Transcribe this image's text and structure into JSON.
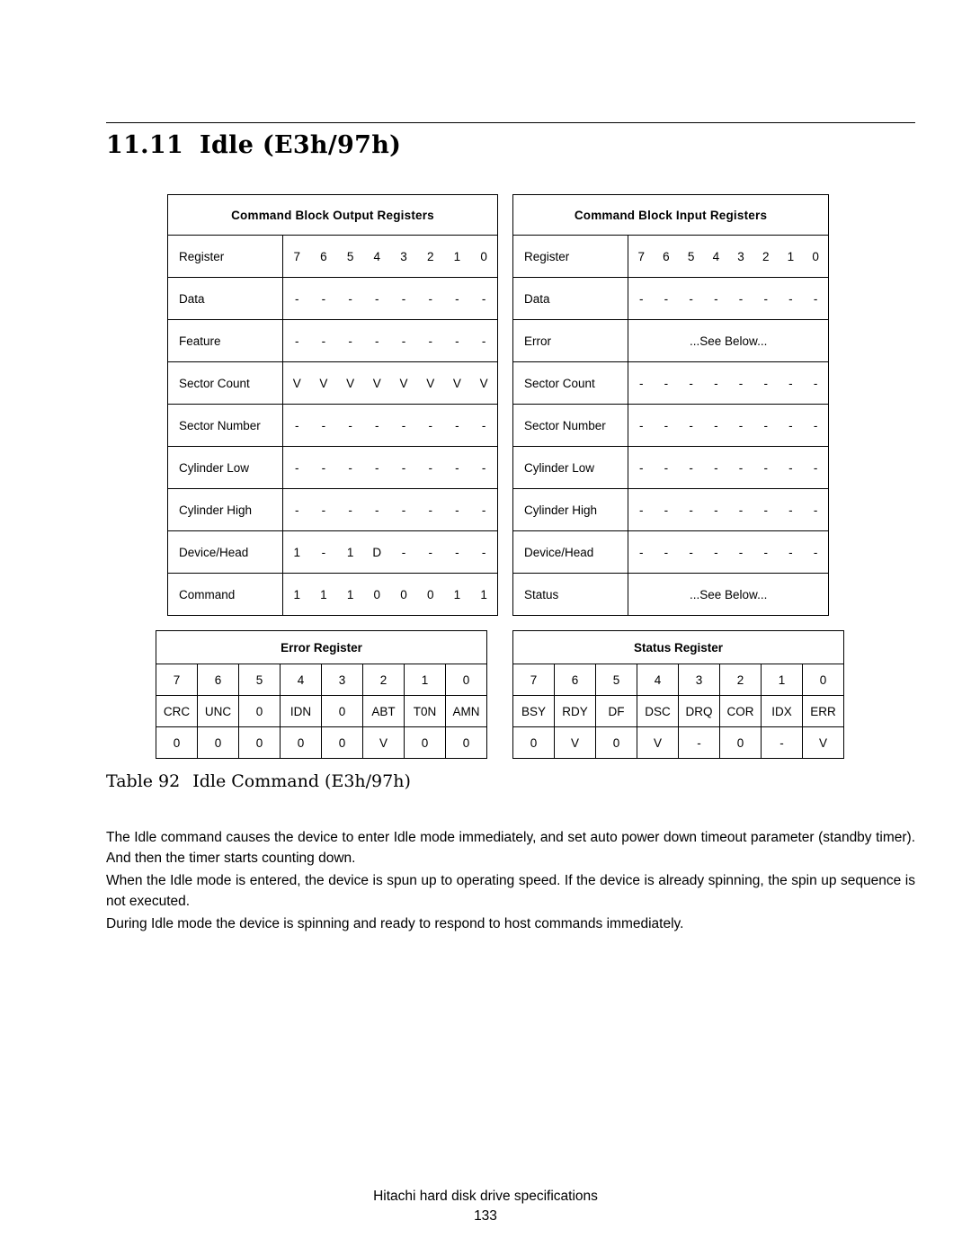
{
  "document": {
    "section_number": "11.11",
    "section_title": "Idle (E3h/97h)",
    "table_caption_label": "Table 92",
    "table_caption_text": "Idle Command (E3h/97h)",
    "paragraphs": [
      "The Idle command causes the device to enter Idle mode immediately, and set auto power down timeout parameter (standby timer). And then the timer starts counting down.",
      "When the Idle mode is entered, the device is spun up to operating speed. If the device is already spinning, the spin up sequence is not executed.",
      "During Idle mode the device is spinning and ready to respond to host commands immediately."
    ],
    "footer_text": "Hitachi hard disk drive specifications",
    "page_number": "133"
  },
  "output_registers": {
    "title": "Command Block Output Registers",
    "bit_header_label": "Register",
    "bit_numbers": [
      "7",
      "6",
      "5",
      "4",
      "3",
      "2",
      "1",
      "0"
    ],
    "rows": [
      {
        "name": "Data",
        "bits": [
          "-",
          "-",
          "-",
          "-",
          "-",
          "-",
          "-",
          "-"
        ]
      },
      {
        "name": "Feature",
        "bits": [
          "-",
          "-",
          "-",
          "-",
          "-",
          "-",
          "-",
          "-"
        ]
      },
      {
        "name": "Sector Count",
        "bits": [
          "V",
          "V",
          "V",
          "V",
          "V",
          "V",
          "V",
          "V"
        ]
      },
      {
        "name": "Sector Number",
        "bits": [
          "-",
          "-",
          "-",
          "-",
          "-",
          "-",
          "-",
          "-"
        ]
      },
      {
        "name": "Cylinder Low",
        "bits": [
          "-",
          "-",
          "-",
          "-",
          "-",
          "-",
          "-",
          "-"
        ]
      },
      {
        "name": "Cylinder High",
        "bits": [
          "-",
          "-",
          "-",
          "-",
          "-",
          "-",
          "-",
          "-"
        ]
      },
      {
        "name": "Device/Head",
        "bits": [
          "1",
          "-",
          "1",
          "D",
          "-",
          "-",
          "-",
          "-"
        ]
      },
      {
        "name": "Command",
        "bits": [
          "1",
          "1",
          "1",
          "0",
          "0",
          "0",
          "1",
          "1"
        ]
      }
    ]
  },
  "input_registers": {
    "title": "Command Block Input Registers",
    "bit_header_label": "Register",
    "bit_numbers": [
      "7",
      "6",
      "5",
      "4",
      "3",
      "2",
      "1",
      "0"
    ],
    "see_below_text": "...See Below...",
    "rows": [
      {
        "name": "Data",
        "bits": [
          "-",
          "-",
          "-",
          "-",
          "-",
          "-",
          "-",
          "-"
        ],
        "see_below": false
      },
      {
        "name": "Error",
        "bits": [],
        "see_below": true
      },
      {
        "name": "Sector Count",
        "bits": [
          "-",
          "-",
          "-",
          "-",
          "-",
          "-",
          "-",
          "-"
        ],
        "see_below": false
      },
      {
        "name": "Sector Number",
        "bits": [
          "-",
          "-",
          "-",
          "-",
          "-",
          "-",
          "-",
          "-"
        ],
        "see_below": false
      },
      {
        "name": "Cylinder Low",
        "bits": [
          "-",
          "-",
          "-",
          "-",
          "-",
          "-",
          "-",
          "-"
        ],
        "see_below": false
      },
      {
        "name": "Cylinder High",
        "bits": [
          "-",
          "-",
          "-",
          "-",
          "-",
          "-",
          "-",
          "-"
        ],
        "see_below": false
      },
      {
        "name": "Device/Head",
        "bits": [
          "-",
          "-",
          "-",
          "-",
          "-",
          "-",
          "-",
          "-"
        ],
        "see_below": false
      },
      {
        "name": "Status",
        "bits": [],
        "see_below": true
      }
    ]
  },
  "error_register": {
    "title": "Error Register",
    "bit_numbers": [
      "7",
      "6",
      "5",
      "4",
      "3",
      "2",
      "1",
      "0"
    ],
    "bit_names": [
      "CRC",
      "UNC",
      "0",
      "IDN",
      "0",
      "ABT",
      "T0N",
      "AMN"
    ],
    "bit_values": [
      "0",
      "0",
      "0",
      "0",
      "0",
      "V",
      "0",
      "0"
    ]
  },
  "status_register": {
    "title": "Status Register",
    "bit_numbers": [
      "7",
      "6",
      "5",
      "4",
      "3",
      "2",
      "1",
      "0"
    ],
    "bit_names": [
      "BSY",
      "RDY",
      "DF",
      "DSC",
      "DRQ",
      "COR",
      "IDX",
      "ERR"
    ],
    "bit_values": [
      "0",
      "V",
      "0",
      "V",
      "-",
      "0",
      "-",
      "V"
    ]
  }
}
